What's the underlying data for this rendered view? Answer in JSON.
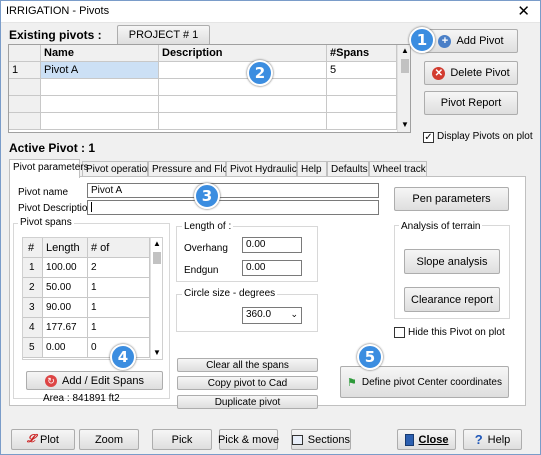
{
  "window": {
    "title": "IRRIGATION - Pivots",
    "close": "✕"
  },
  "existing": {
    "label": "Existing pivots :",
    "project_tab": "PROJECT # 1",
    "columns": [
      "Name",
      "Description",
      "#Spans"
    ],
    "rows": [
      {
        "num": "1",
        "name": "Pivot A",
        "description": "",
        "spans": "5"
      }
    ]
  },
  "side": {
    "add_pivot": "Add Pivot",
    "delete_pivot": "Delete Pivot",
    "pivot_report": "Pivot Report",
    "display_on_plot": "Display Pivots on plot",
    "display_checked": "✓"
  },
  "active_pivot": "Active Pivot : 1",
  "tabs": [
    "Pivot parameters",
    "Pivot operation",
    "Pressure and Flow",
    "Pivot Hydraulics",
    "Help",
    "Defaults",
    "Wheel track"
  ],
  "params": {
    "name_label": "Pivot name",
    "name_value": "Pivot A",
    "desc_label": "Pivot Description",
    "desc_value": "",
    "pen_parameters": "Pen parameters"
  },
  "spans": {
    "group": "Pivot spans",
    "columns": [
      "#",
      "Length",
      "# of"
    ],
    "rows": [
      {
        "num": "1",
        "length": "100.00",
        "count": "2"
      },
      {
        "num": "2",
        "length": "50.00",
        "count": "1"
      },
      {
        "num": "3",
        "length": "90.00",
        "count": "1"
      },
      {
        "num": "4",
        "length": "177.67",
        "count": "1"
      },
      {
        "num": "5",
        "length": "0.00",
        "count": "0"
      }
    ],
    "add_edit": "Add / Edit Spans",
    "area": "Area : 841891 ft2"
  },
  "length_of": {
    "group": "Length of :",
    "overhang_label": "Overhang",
    "overhang_value": "0.00",
    "endgun_label": "Endgun",
    "endgun_value": "0.00"
  },
  "circle": {
    "group": "Circle size - degrees",
    "value": "360.0"
  },
  "span_buttons": {
    "clear": "Clear all the spans",
    "copy": "Copy pivot to Cad",
    "duplicate": "Duplicate pivot"
  },
  "terrain": {
    "group": "Analysis of terrain",
    "slope": "Slope analysis",
    "clearance": "Clearance report"
  },
  "hide_on_plot": "Hide this Pivot on plot",
  "define_center": "Define pivot Center coordinates",
  "footer": {
    "plot": "Plot",
    "zoom": "Zoom",
    "pick": "Pick",
    "pick_move": "Pick & move",
    "sections": "Sections",
    "close": "Close",
    "help": "Help"
  },
  "badges": [
    "1",
    "2",
    "3",
    "4",
    "5"
  ],
  "colors": {
    "badge": "#3b8de0",
    "selection": "#cce0f5"
  }
}
